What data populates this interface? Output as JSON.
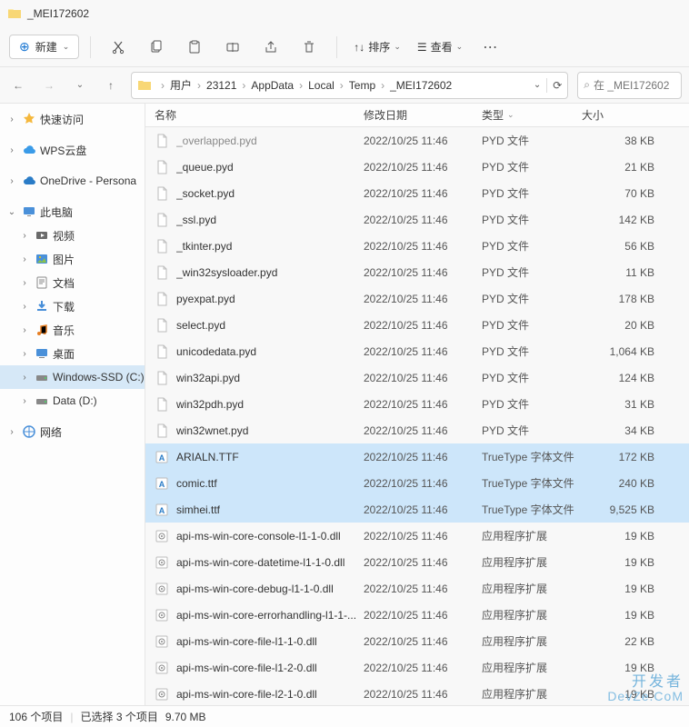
{
  "window": {
    "title": "_MEI172602"
  },
  "toolbar": {
    "new_label": "新建",
    "sort_label": "排序",
    "view_label": "查看"
  },
  "addressbar": {
    "crumbs": [
      "用户",
      "23121",
      "AppData",
      "Local",
      "Temp",
      "_MEI172602"
    ]
  },
  "search": {
    "placeholder": "在 _MEI172602"
  },
  "sidebar": {
    "items": [
      {
        "name": "quick-access",
        "label": "快速访问",
        "icon": "star",
        "chev": "›",
        "indent": 0
      },
      {
        "name": "wps-cloud",
        "label": "WPS云盘",
        "icon": "cloud-blue",
        "chev": "›",
        "indent": 0
      },
      {
        "name": "onedrive",
        "label": "OneDrive - Persona",
        "icon": "cloud-blue2",
        "chev": "›",
        "indent": 0
      },
      {
        "name": "this-pc",
        "label": "此电脑",
        "icon": "monitor",
        "chev": "⌄",
        "indent": 0
      },
      {
        "name": "videos",
        "label": "视频",
        "icon": "video",
        "chev": "›",
        "indent": 1
      },
      {
        "name": "pictures",
        "label": "图片",
        "icon": "picture",
        "chev": "›",
        "indent": 1
      },
      {
        "name": "documents",
        "label": "文档",
        "icon": "doc",
        "chev": "›",
        "indent": 1
      },
      {
        "name": "downloads",
        "label": "下载",
        "icon": "download",
        "chev": "›",
        "indent": 1
      },
      {
        "name": "music",
        "label": "音乐",
        "icon": "music",
        "chev": "›",
        "indent": 1
      },
      {
        "name": "desktop",
        "label": "桌面",
        "icon": "desktop",
        "chev": "›",
        "indent": 1
      },
      {
        "name": "drive-c",
        "label": "Windows-SSD (C:)",
        "icon": "drive",
        "chev": "›",
        "indent": 1,
        "selected": true
      },
      {
        "name": "drive-d",
        "label": "Data (D:)",
        "icon": "drive",
        "chev": "›",
        "indent": 1
      },
      {
        "name": "network",
        "label": "网络",
        "icon": "network",
        "chev": "›",
        "indent": 0
      }
    ]
  },
  "columns": {
    "name": "名称",
    "date": "修改日期",
    "type": "类型",
    "size": "大小"
  },
  "files": [
    {
      "name": "_overlapped.pyd",
      "date": "2022/10/25 11:46",
      "type": "PYD 文件",
      "size": "38 KB",
      "icon": "blank",
      "dim": true
    },
    {
      "name": "_queue.pyd",
      "date": "2022/10/25 11:46",
      "type": "PYD 文件",
      "size": "21 KB",
      "icon": "blank"
    },
    {
      "name": "_socket.pyd",
      "date": "2022/10/25 11:46",
      "type": "PYD 文件",
      "size": "70 KB",
      "icon": "blank"
    },
    {
      "name": "_ssl.pyd",
      "date": "2022/10/25 11:46",
      "type": "PYD 文件",
      "size": "142 KB",
      "icon": "blank"
    },
    {
      "name": "_tkinter.pyd",
      "date": "2022/10/25 11:46",
      "type": "PYD 文件",
      "size": "56 KB",
      "icon": "blank"
    },
    {
      "name": "_win32sysloader.pyd",
      "date": "2022/10/25 11:46",
      "type": "PYD 文件",
      "size": "11 KB",
      "icon": "blank"
    },
    {
      "name": "pyexpat.pyd",
      "date": "2022/10/25 11:46",
      "type": "PYD 文件",
      "size": "178 KB",
      "icon": "blank"
    },
    {
      "name": "select.pyd",
      "date": "2022/10/25 11:46",
      "type": "PYD 文件",
      "size": "20 KB",
      "icon": "blank"
    },
    {
      "name": "unicodedata.pyd",
      "date": "2022/10/25 11:46",
      "type": "PYD 文件",
      "size": "1,064 KB",
      "icon": "blank"
    },
    {
      "name": "win32api.pyd",
      "date": "2022/10/25 11:46",
      "type": "PYD 文件",
      "size": "124 KB",
      "icon": "blank"
    },
    {
      "name": "win32pdh.pyd",
      "date": "2022/10/25 11:46",
      "type": "PYD 文件",
      "size": "31 KB",
      "icon": "blank"
    },
    {
      "name": "win32wnet.pyd",
      "date": "2022/10/25 11:46",
      "type": "PYD 文件",
      "size": "34 KB",
      "icon": "blank"
    },
    {
      "name": "ARIALN.TTF",
      "date": "2022/10/25 11:46",
      "type": "TrueType 字体文件",
      "size": "172 KB",
      "icon": "font",
      "selected": true
    },
    {
      "name": "comic.ttf",
      "date": "2022/10/25 11:46",
      "type": "TrueType 字体文件",
      "size": "240 KB",
      "icon": "font",
      "selected": true
    },
    {
      "name": "simhei.ttf",
      "date": "2022/10/25 11:46",
      "type": "TrueType 字体文件",
      "size": "9,525 KB",
      "icon": "font",
      "selected": true
    },
    {
      "name": "api-ms-win-core-console-l1-1-0.dll",
      "date": "2022/10/25 11:46",
      "type": "应用程序扩展",
      "size": "19 KB",
      "icon": "dll"
    },
    {
      "name": "api-ms-win-core-datetime-l1-1-0.dll",
      "date": "2022/10/25 11:46",
      "type": "应用程序扩展",
      "size": "19 KB",
      "icon": "dll"
    },
    {
      "name": "api-ms-win-core-debug-l1-1-0.dll",
      "date": "2022/10/25 11:46",
      "type": "应用程序扩展",
      "size": "19 KB",
      "icon": "dll"
    },
    {
      "name": "api-ms-win-core-errorhandling-l1-1-...",
      "date": "2022/10/25 11:46",
      "type": "应用程序扩展",
      "size": "19 KB",
      "icon": "dll"
    },
    {
      "name": "api-ms-win-core-file-l1-1-0.dll",
      "date": "2022/10/25 11:46",
      "type": "应用程序扩展",
      "size": "22 KB",
      "icon": "dll"
    },
    {
      "name": "api-ms-win-core-file-l1-2-0.dll",
      "date": "2022/10/25 11:46",
      "type": "应用程序扩展",
      "size": "19 KB",
      "icon": "dll"
    },
    {
      "name": "api-ms-win-core-file-l2-1-0.dll",
      "date": "2022/10/25 11:46",
      "type": "应用程序扩展",
      "size": "19 KB",
      "icon": "dll"
    }
  ],
  "status": {
    "total": "106 个项目",
    "selected": "已选择 3 个项目",
    "size": "9.70 MB"
  },
  "watermark": {
    "line1": "开发者",
    "line2": "DevZe.CoM"
  },
  "icons": {
    "folder": "folder-icon",
    "plus": "plus-icon"
  }
}
